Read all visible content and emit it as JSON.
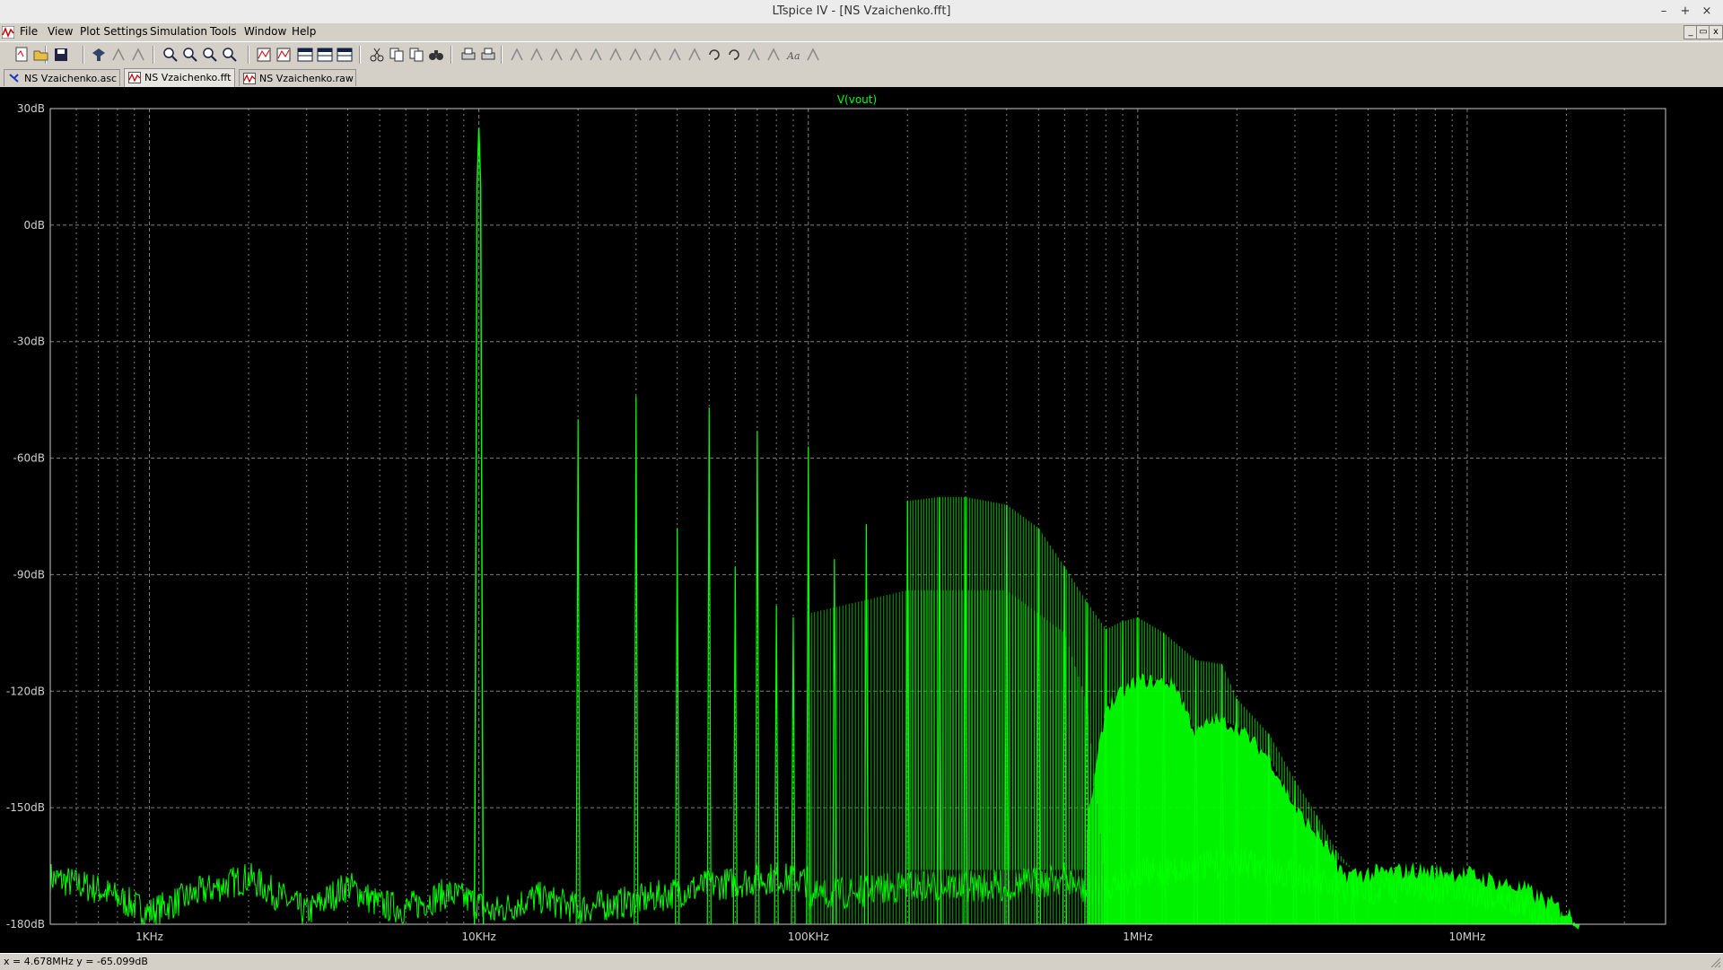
{
  "window": {
    "title": "LTspice IV - [NS Vzaichenko.fft]",
    "minimize": "–",
    "maximize": "+",
    "close": "×"
  },
  "menu": [
    "File",
    "View",
    "Plot Settings",
    "Simulation",
    "Tools",
    "Window",
    "Help"
  ],
  "toolbar_icons": [
    "new-schematic-icon",
    "open-icon",
    "save-icon",
    "control-panel-icon",
    "run-icon",
    "halt-icon",
    "zoom-in-icon",
    "zoom-area-icon",
    "zoom-out-icon",
    "zoom-cancel-icon",
    "autorange-icon",
    "manual-limits-icon",
    "tile-horizontal-icon",
    "tile-vertical-icon",
    "cascade-icon",
    "cut-icon",
    "copy-icon",
    "paste-icon",
    "find-icon",
    "print-preview-icon",
    "print-icon",
    "wire-icon",
    "ground-icon",
    "label-icon",
    "resistor-icon",
    "capacitor-icon",
    "inductor-icon",
    "diode-icon",
    "component-icon",
    "move-icon",
    "drag-icon",
    "undo-icon",
    "redo-icon",
    "rotate-icon",
    "mirror-icon",
    "text-icon",
    "spice-directive-icon"
  ],
  "tabs": [
    {
      "label": "NS Vzaichenko.asc",
      "icon": "schematic-icon",
      "active": false
    },
    {
      "label": "NS Vzaichenko.fft",
      "icon": "waveform-icon",
      "active": true
    },
    {
      "label": "NS Vzaichenko.raw",
      "icon": "waveform-icon",
      "active": false
    }
  ],
  "status": {
    "readout": "x = 4.678MHz    y = -65.099dB"
  },
  "colors": {
    "trace": "#00ff00",
    "trace_dim": "#10a010",
    "grid": "#808080",
    "axis": "#c8c8c8",
    "background": "#000000"
  },
  "chart_data": {
    "type": "line",
    "title": "V(vout)",
    "xscale": "log",
    "xlim": [
      500,
      40000000
    ],
    "ylim": [
      -180,
      30
    ],
    "yticks": [
      30,
      0,
      -30,
      -60,
      -90,
      -120,
      -150,
      -180
    ],
    "ytick_labels": [
      "30dB",
      "0dB",
      "-30dB",
      "-60dB",
      "-90dB",
      "-120dB",
      "-150dB",
      "-180dB"
    ],
    "xticks": [
      1000,
      10000,
      100000,
      1000000,
      10000000
    ],
    "xtick_labels": [
      "1KHz",
      "10KHz",
      "100KHz",
      "1MHz",
      "10MHz"
    ],
    "grid": true,
    "series": [
      {
        "name": "V(vout)",
        "fundamental": {
          "x": 10000,
          "y": 25
        },
        "noise_floor": [
          [
            500,
            -168
          ],
          [
            700,
            -171
          ],
          [
            1000,
            -177
          ],
          [
            1400,
            -172
          ],
          [
            2000,
            -168
          ],
          [
            3000,
            -177
          ],
          [
            4000,
            -170
          ],
          [
            5000,
            -175
          ],
          [
            6000,
            -176
          ],
          [
            8000,
            -172
          ],
          [
            9500,
            -174
          ],
          [
            11000,
            -177
          ],
          [
            15000,
            -173
          ],
          [
            20000,
            -176
          ],
          [
            30000,
            -174
          ],
          [
            50000,
            -170
          ],
          [
            80000,
            -168
          ],
          [
            100000,
            -169
          ],
          [
            200000,
            -166
          ],
          [
            400000,
            -166
          ],
          [
            600000,
            -164
          ],
          [
            700000,
            -168
          ],
          [
            1000000,
            -163
          ],
          [
            2000000,
            -160
          ],
          [
            3000000,
            -163
          ],
          [
            4000000,
            -167
          ],
          [
            5000000,
            -167
          ],
          [
            7000000,
            -166
          ],
          [
            10000000,
            -167
          ],
          [
            15000000,
            -171
          ],
          [
            20000000,
            -177
          ],
          [
            22000000,
            -180
          ]
        ],
        "harmonic_peaks": [
          [
            20000,
            -50
          ],
          [
            30000,
            -44
          ],
          [
            40000,
            -78
          ],
          [
            50000,
            -47
          ],
          [
            60000,
            -88
          ],
          [
            70000,
            -53
          ],
          [
            80000,
            -98
          ],
          [
            90000,
            -101
          ],
          [
            100000,
            -57
          ],
          [
            120000,
            -86
          ],
          [
            150000,
            -77
          ],
          [
            200000,
            -71
          ],
          [
            250000,
            -70
          ],
          [
            300000,
            -70
          ],
          [
            400000,
            -72
          ],
          [
            500000,
            -78
          ],
          [
            600000,
            -88
          ],
          [
            700000,
            -97
          ],
          [
            800000,
            -104
          ],
          [
            900000,
            -102
          ],
          [
            1000000,
            -101
          ],
          [
            1200000,
            -105
          ],
          [
            1500000,
            -112
          ],
          [
            1800000,
            -113
          ],
          [
            2000000,
            -122
          ],
          [
            2500000,
            -131
          ],
          [
            3000000,
            -143
          ],
          [
            3500000,
            -152
          ],
          [
            4000000,
            -161
          ],
          [
            4500000,
            -166
          ]
        ],
        "envelopes": [
          {
            "name": "",
            "points": [
              [
                100000,
                -100
              ],
              [
                200000,
                -94
              ],
              [
                400000,
                -94
              ],
              [
                600000,
                -105
              ],
              [
                700000,
                -123
              ],
              [
                800000,
                -170
              ]
            ]
          },
          {
            "name": "",
            "points": [
              [
                700000,
                -155
              ],
              [
                800000,
                -124
              ],
              [
                1000000,
                -117
              ],
              [
                1300000,
                -118
              ],
              [
                1500000,
                -131
              ],
              [
                1700000,
                -127
              ],
              [
                2000000,
                -129
              ],
              [
                2500000,
                -137
              ],
              [
                3000000,
                -150
              ],
              [
                4000000,
                -163
              ]
            ]
          }
        ]
      }
    ]
  }
}
